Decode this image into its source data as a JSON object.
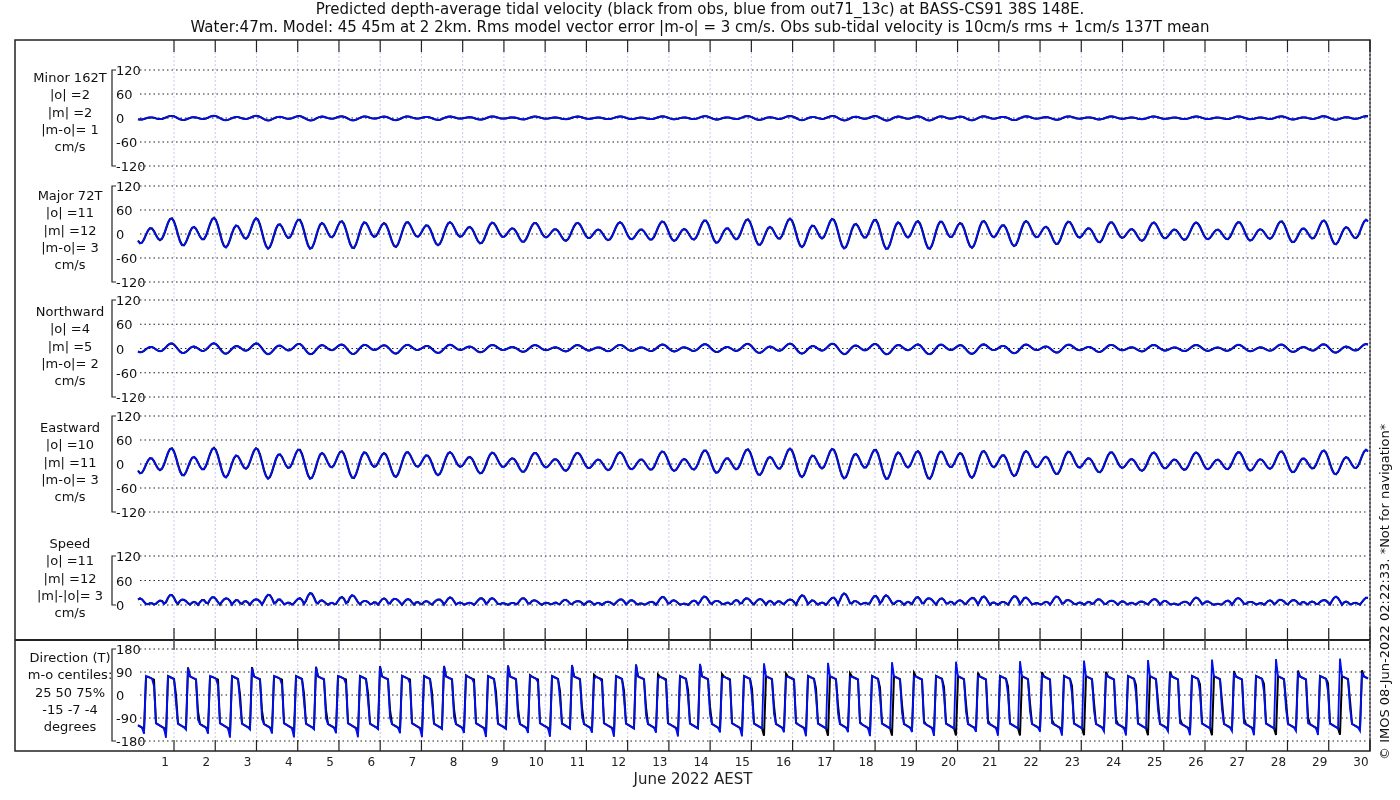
{
  "title_lines": [
    "Predicted depth-average tidal velocity (black from obs, blue from out71_13c) at BASS-CS91 38S 148E.",
    "Water:47m. Model: 45 45m at 2 2km. Rms model vector error |m-o| = 3 cm/s. Obs sub-tidal velocity is 10cm/s rms + 1cm/s 137T mean"
  ],
  "panels": [
    {
      "kind": "velocity",
      "label_lines": [
        "Minor 162T",
        "|o| =2",
        "|m| =2",
        "|m-o|= 1",
        "cm/s"
      ],
      "yticks": [
        "120",
        "60",
        "0",
        "-60",
        "-120"
      ]
    },
    {
      "kind": "velocity",
      "label_lines": [
        "Major 72T",
        "|o| =11",
        "|m| =12",
        "|m-o|= 3",
        "cm/s"
      ],
      "yticks": [
        "120",
        "60",
        "0",
        "-60",
        "-120"
      ]
    },
    {
      "kind": "velocity",
      "label_lines": [
        "Northward",
        "|o| =4",
        "|m| =5",
        "|m-o|= 2",
        "cm/s"
      ],
      "yticks": [
        "120",
        "60",
        "0",
        "-60",
        "-120"
      ]
    },
    {
      "kind": "velocity",
      "label_lines": [
        "Eastward",
        "|o| =10",
        "|m| =11",
        "|m-o|= 3",
        "cm/s"
      ],
      "yticks": [
        "120",
        "60",
        "0",
        "-60",
        "-120"
      ]
    },
    {
      "kind": "speed",
      "label_lines": [
        "Speed",
        "|o| =11",
        "|m| =12",
        "|m|-|o|= 3",
        "cm/s"
      ],
      "yticks": [
        "120",
        "60",
        "0"
      ]
    },
    {
      "kind": "direction",
      "label_lines": [
        "Direction (T)",
        "m-o centiles:",
        "25  50  75%",
        "-15  -7  -4",
        "degrees"
      ],
      "yticks": [
        "180",
        "90",
        "0",
        "-90",
        "-180"
      ]
    }
  ],
  "x_axis": {
    "ticks": [
      "1",
      "2",
      "3",
      "4",
      "5",
      "6",
      "7",
      "8",
      "9",
      "10",
      "11",
      "12",
      "13",
      "14",
      "15",
      "16",
      "17",
      "18",
      "19",
      "20",
      "21",
      "22",
      "23",
      "24",
      "25",
      "26",
      "27",
      "28",
      "29",
      "30"
    ],
    "label": "June 2022 AEST"
  },
  "credit": "© IMOS 08-Jun-2022 02:22:33. *Not for navigation*"
}
